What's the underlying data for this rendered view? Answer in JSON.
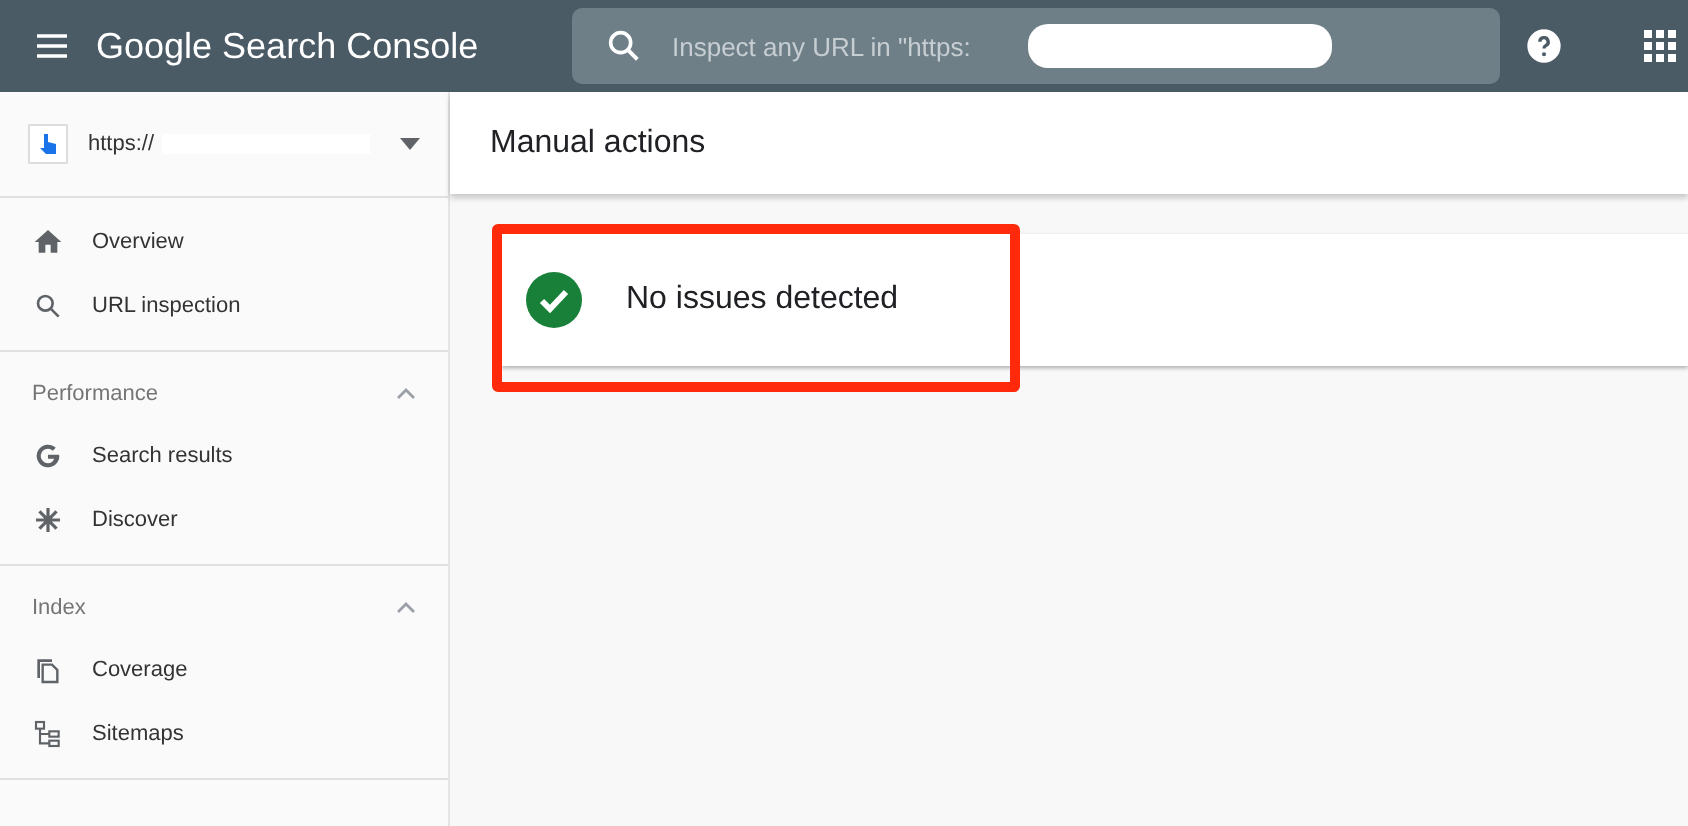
{
  "top_bar": {
    "title": "Google Search Console",
    "search": {
      "placeholder": "Inspect any URL in \"https:"
    }
  },
  "sidebar": {
    "property": "https://",
    "groups": [
      {
        "items": [
          "Overview",
          "URL inspection"
        ]
      },
      {
        "heading": "Performance",
        "expanded": true,
        "items": [
          "Search results",
          "Discover"
        ]
      },
      {
        "heading": "Index",
        "expanded": true,
        "items": [
          "Coverage",
          "Sitemaps"
        ]
      }
    ]
  },
  "page": {
    "title": "Manual actions",
    "status": "No issues detected"
  }
}
